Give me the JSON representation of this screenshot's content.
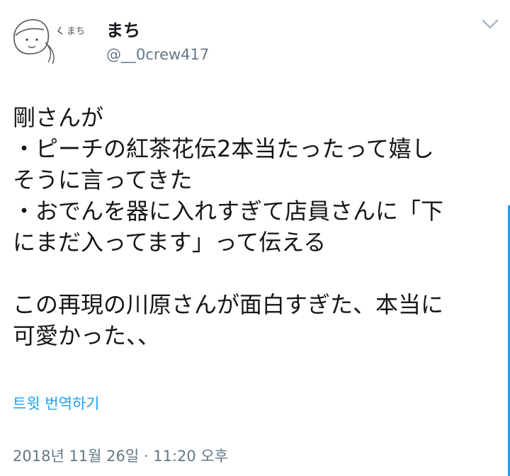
{
  "author": {
    "display_name": "まち",
    "handle": "@__0crew417",
    "avatar_doodle_text": "まち"
  },
  "tweet": {
    "lines": [
      "剛さんが",
      "・ピーチの紅茶花伝2本当たったって嬉し",
      "そうに言ってきた",
      "・おでんを器に入れすぎて店員さんに「下",
      "にまだ入ってます」って伝える",
      "",
      "この再現の川原さんが面白すぎた、本当に",
      "可愛かった、、"
    ],
    "translate_label": "트윗 번역하기",
    "timestamp": "2018년 11월 26일 · 11:20 오후"
  },
  "icons": {
    "menu": "chevron-down-icon",
    "avatar": "doodle-avatar-icon"
  },
  "colors": {
    "link": "#1da1f2",
    "muted": "#657786",
    "text": "#14171a"
  }
}
